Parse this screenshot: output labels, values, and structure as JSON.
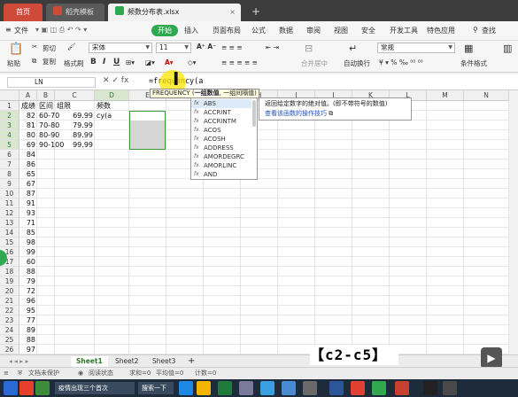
{
  "tabs": {
    "home": "首页",
    "template": "稻壳模板",
    "file": "频数分布表.xlsx",
    "add": "+"
  },
  "menu": {
    "file": "文件",
    "start": "开始",
    "insert": "插入",
    "layout": "页面布局",
    "formula": "公式",
    "data": "数据",
    "review": "审阅",
    "view": "视图",
    "security": "安全",
    "dev": "开发工具",
    "special": "特色应用",
    "search": "查找"
  },
  "ribbon": {
    "paste": "粘贴",
    "cut": "剪切",
    "copy": "复制",
    "format_painter": "格式刷",
    "font_name": "宋体",
    "font_size": "11",
    "merge_center": "合并居中",
    "wrap": "自动换行",
    "number_format": "常规",
    "cond_format": "条件格式"
  },
  "formula_bar": {
    "name_box": "LN",
    "icons": "✕ ✓ fx",
    "content": "=frequency(a"
  },
  "columns": [
    "A",
    "B",
    "C",
    "D",
    "E",
    "F",
    "G",
    "H",
    "I",
    "J",
    "K",
    "L",
    "M",
    "N"
  ],
  "rows": [
    "1",
    "2",
    "3",
    "4",
    "5",
    "6",
    "7",
    "8",
    "9",
    "10",
    "11",
    "12",
    "13",
    "14",
    "15",
    "16",
    "17",
    "18",
    "19",
    "20",
    "21",
    "22",
    "23",
    "24",
    "25",
    "26"
  ],
  "cells": {
    "header": [
      "成绩",
      "区间",
      "组限",
      "频数"
    ],
    "scores": [
      "82",
      "81",
      "80",
      "69",
      "84",
      "86",
      "65",
      "67",
      "87",
      "91",
      "93",
      "71",
      "85",
      "98",
      "99",
      "60",
      "88",
      "79",
      "72",
      "96",
      "95",
      "77",
      "89",
      "88",
      "97"
    ],
    "intervals": [
      "60-70",
      "70-80",
      "80-90",
      "90-100"
    ],
    "limits": [
      "69.99",
      "79.99",
      "89.99",
      "99.99"
    ],
    "editing": "cy(a"
  },
  "autocomplete": {
    "hint_fn": "FREQUENCY",
    "hint_arg1": "一组数值",
    "hint_rest": "一组间隔值)",
    "items": [
      "ABS",
      "ACCRINT",
      "ACCRINTM",
      "ACOS",
      "ACOSH",
      "ADDRESS",
      "AMORDEGRC",
      "AMORLINC",
      "AND"
    ],
    "desc_line1": "返回给定数字的绝对值。(即不带符号的数值)",
    "desc_link": "查看该函数的操作技巧"
  },
  "sheets": [
    "Sheet1",
    "Sheet2",
    "Sheet3"
  ],
  "sheet_add": "+",
  "caption": "【c2-c5】",
  "status": {
    "protect": "文档未保护",
    "read": "阅读状态",
    "sum": "求和=0",
    "avg": "平均值=0",
    "count": "计数=0"
  },
  "taskbar": {
    "task1": "疫情出现三个首次",
    "search": "搜索一下"
  }
}
